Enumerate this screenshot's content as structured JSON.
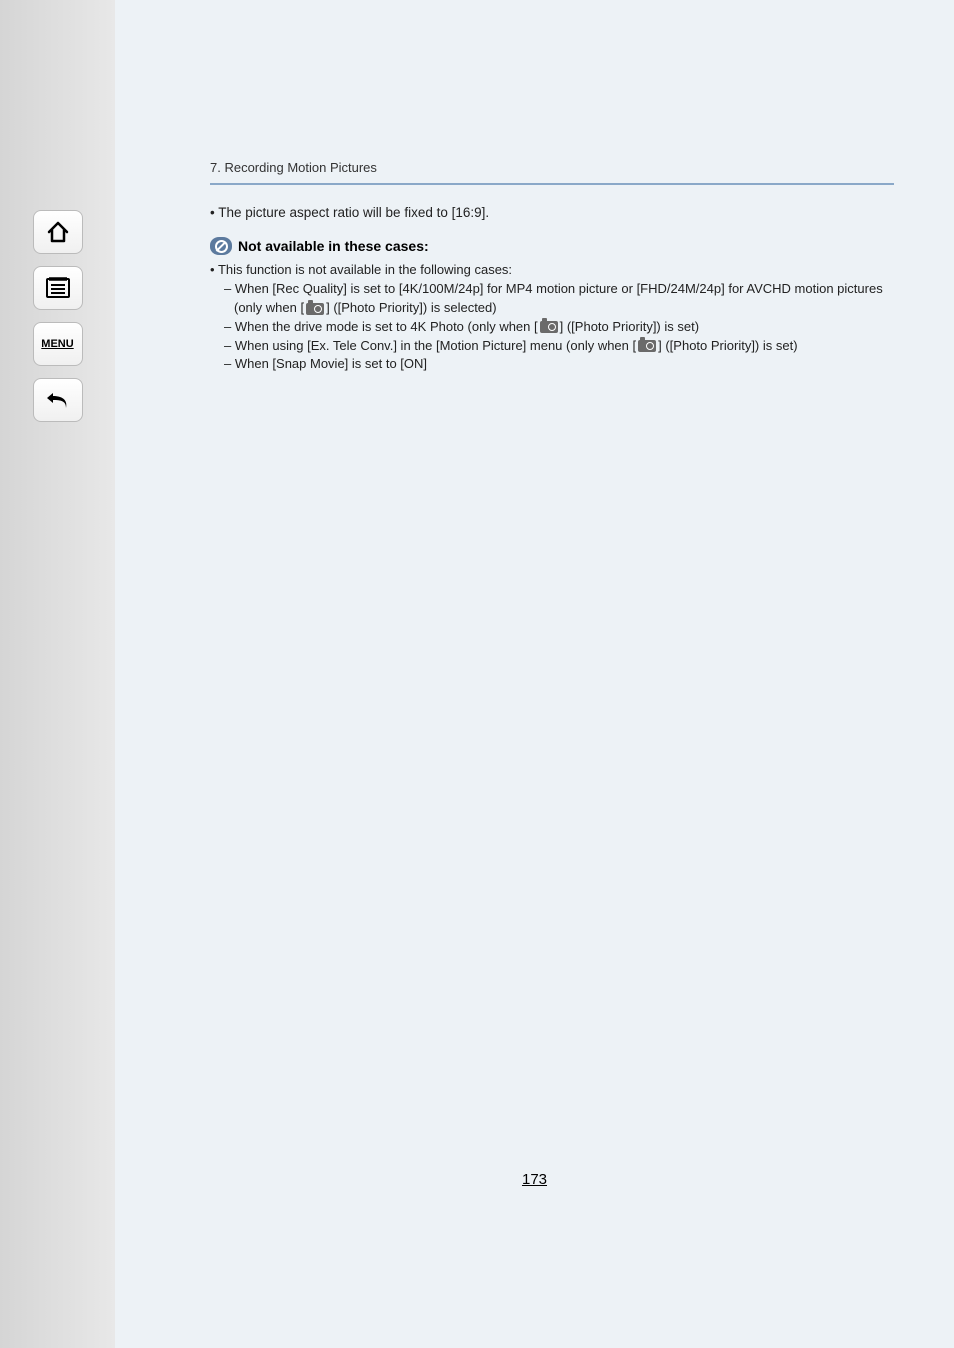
{
  "nav": {
    "home_label": "home-icon",
    "toc_label": "toc-icon",
    "menu_label": "MENU",
    "back_label": "back-icon"
  },
  "chapter": "7. Recording Motion Pictures",
  "bullet1_prefix": "• ",
  "bullet1_text": "The picture aspect ratio will be fixed to [16:9].",
  "note_heading": "Not available in these cases:",
  "sub_bullet_prefix": "• ",
  "sub_bullet_text": "This function is not available in the following cases:",
  "dash": "– ",
  "dash1_a": "When [Rec Quality] is set to [4K/100M/24p] for MP4 motion picture or [FHD/24M/24p] for AVCHD motion pictures (only when [",
  "dash1_b": "] ([Photo Priority]) is selected)",
  "dash2_a": "When the drive mode is set to 4K Photo (only when [",
  "dash2_b": "] ([Photo Priority]) is set)",
  "dash3_a": "When using [Ex. Tele Conv.] in the [Motion Picture] menu (only when [",
  "dash3_b": "] ([Photo Priority]) is set)",
  "dash4": "When [Snap Movie] is set to [ON]",
  "page_number": "173"
}
